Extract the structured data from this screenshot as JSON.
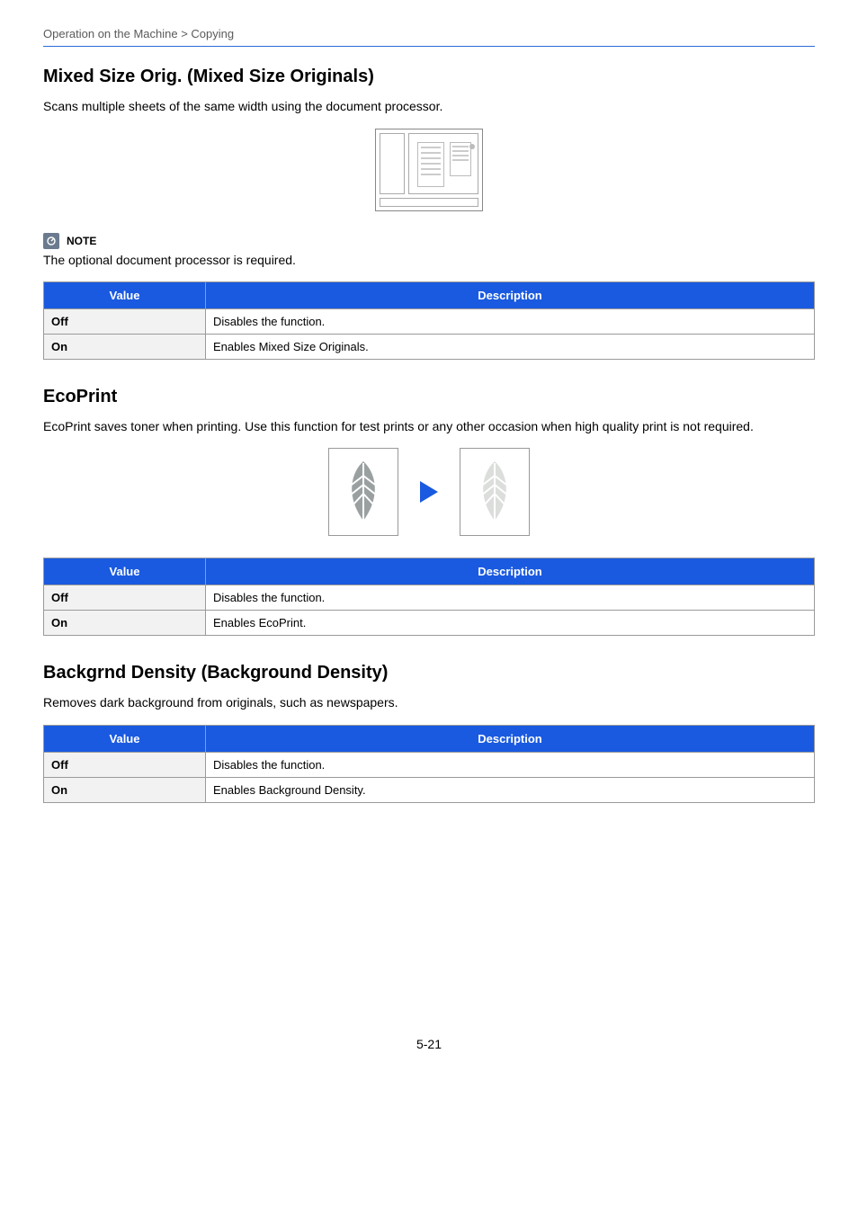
{
  "breadcrumb": "Operation on the Machine > Copying",
  "sections": {
    "mixed": {
      "heading": "Mixed Size Orig. (Mixed Size Originals)",
      "intro": "Scans multiple sheets of the same width using the document processor.",
      "note_label": "NOTE",
      "note_text": "The optional document processor is required.",
      "table": {
        "head_value": "Value",
        "head_desc": "Description",
        "rows": [
          {
            "k": "Off",
            "v": "Disables the function."
          },
          {
            "k": "On",
            "v": "Enables Mixed Size Originals."
          }
        ]
      }
    },
    "eco": {
      "heading": "EcoPrint",
      "intro": "EcoPrint saves toner when printing. Use this function for test prints or any other occasion when high quality print is not required.",
      "table": {
        "head_value": "Value",
        "head_desc": "Description",
        "rows": [
          {
            "k": "Off",
            "v": "Disables the function."
          },
          {
            "k": "On",
            "v": "Enables EcoPrint."
          }
        ]
      }
    },
    "bg": {
      "heading": "Backgrnd Density (Background Density)",
      "intro": "Removes dark background from originals, such as newspapers.",
      "table": {
        "head_value": "Value",
        "head_desc": "Description",
        "rows": [
          {
            "k": "Off",
            "v": "Disables the function."
          },
          {
            "k": "On",
            "v": "Enables Background Density."
          }
        ]
      }
    }
  },
  "page_number": "5-21"
}
